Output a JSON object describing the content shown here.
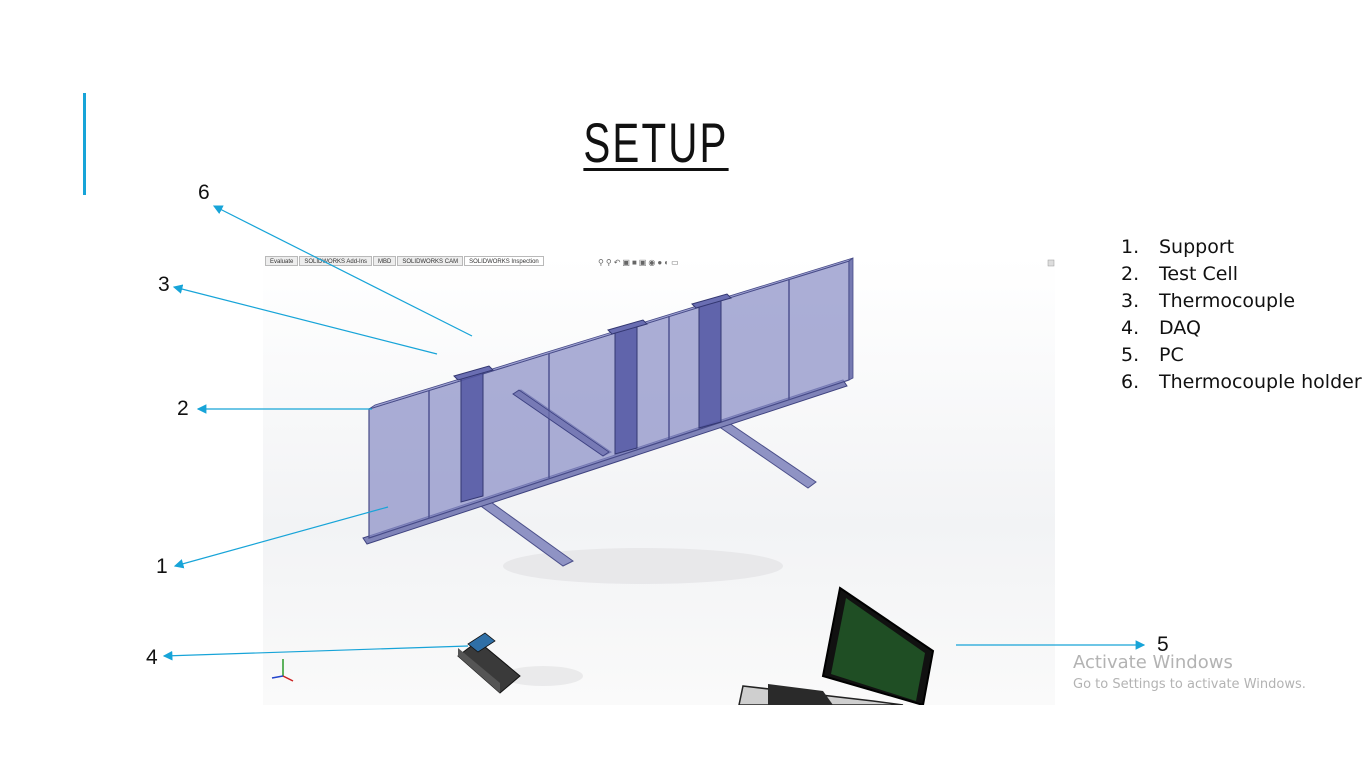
{
  "slide": {
    "title": "SETUP",
    "accent_color": "#17a4d8"
  },
  "legend": [
    {
      "number": "1.",
      "label": "Support"
    },
    {
      "number": "2.",
      "label": "Test Cell"
    },
    {
      "number": "3.",
      "label": "Thermocouple"
    },
    {
      "number": "4.",
      "label": "DAQ"
    },
    {
      "number": "5.",
      "label": "PC"
    },
    {
      "number": "6.",
      "label": "Thermocouple holder"
    }
  ],
  "callouts": {
    "n1": "1",
    "n2": "2",
    "n3": "3",
    "n4": "4",
    "n5": "5",
    "n6": "6"
  },
  "cad_view": {
    "tabs": [
      "Evaluate",
      "SOLIDWORKS Add-Ins",
      "MBD",
      "SOLIDWORKS CAM",
      "SOLIDWORKS Inspection"
    ],
    "active_tab": "SOLIDWORKS Inspection",
    "toolbar_icons": [
      "zoom-fit-icon",
      "zoom-area-icon",
      "previous-view-icon",
      "section-view-icon",
      "view-orientation-icon",
      "display-style-icon",
      "hide-show-icon",
      "appearance-icon",
      "scene-icon",
      "display-icon"
    ]
  },
  "watermark": {
    "title": "Activate Windows",
    "subtitle": "Go to Settings to activate Windows."
  }
}
